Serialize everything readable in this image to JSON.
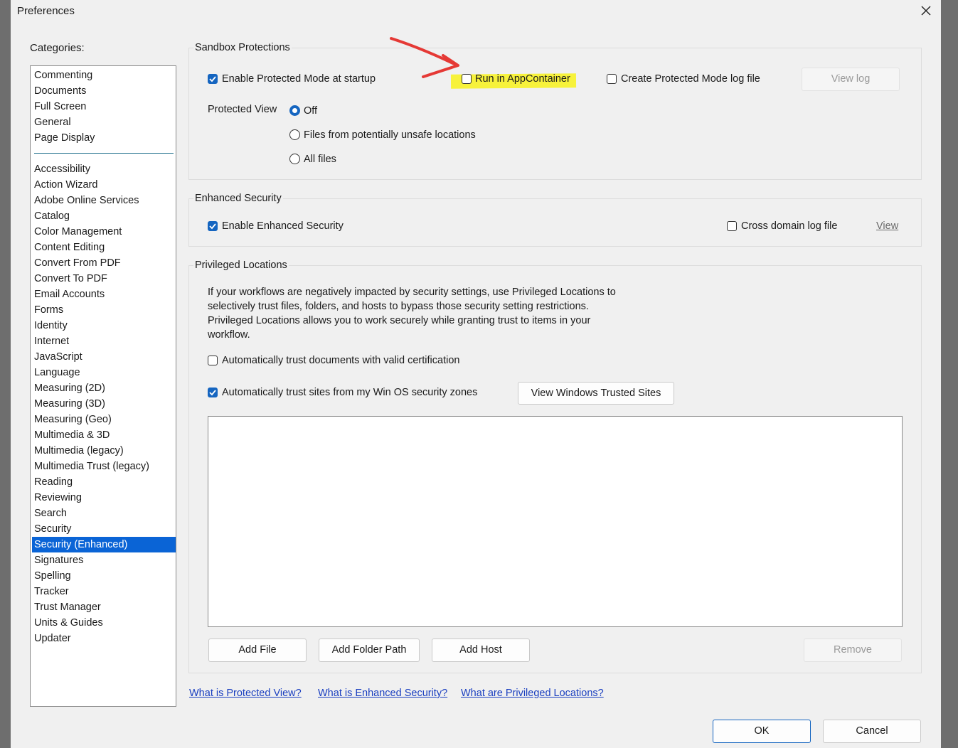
{
  "window": {
    "title": "Preferences"
  },
  "categories": {
    "label": "Categories:",
    "top_items": [
      "Commenting",
      "Documents",
      "Full Screen",
      "General",
      "Page Display"
    ],
    "items": [
      "Accessibility",
      "Action Wizard",
      "Adobe Online Services",
      "Catalog",
      "Color Management",
      "Content Editing",
      "Convert From PDF",
      "Convert To PDF",
      "Email Accounts",
      "Forms",
      "Identity",
      "Internet",
      "JavaScript",
      "Language",
      "Measuring (2D)",
      "Measuring (3D)",
      "Measuring (Geo)",
      "Multimedia & 3D",
      "Multimedia (legacy)",
      "Multimedia Trust (legacy)",
      "Reading",
      "Reviewing",
      "Search",
      "Security",
      "Security (Enhanced)",
      "Signatures",
      "Spelling",
      "Tracker",
      "Trust Manager",
      "Units & Guides",
      "Updater"
    ],
    "selected": "Security (Enhanced)"
  },
  "sandbox": {
    "legend": "Sandbox Protections",
    "enable_protected_mode": {
      "label": "Enable Protected Mode at startup",
      "checked": true
    },
    "run_in_appcontainer": {
      "label": "Run in AppContainer",
      "checked": false
    },
    "create_log": {
      "label": "Create Protected Mode log file",
      "checked": false
    },
    "view_log_button": "View log",
    "protected_view_label": "Protected View",
    "protected_view_options": [
      "Off",
      "Files from potentially unsafe locations",
      "All files"
    ],
    "protected_view_selected": "Off"
  },
  "enhanced": {
    "legend": "Enhanced Security",
    "enable_enhanced": {
      "label": "Enable Enhanced Security",
      "checked": true
    },
    "cross_domain": {
      "label": "Cross domain log file",
      "checked": false
    },
    "view_link": "View"
  },
  "privileged": {
    "legend": "Privileged Locations",
    "description_lines": [
      "If your workflows are negatively impacted by security settings, use Privileged Locations to",
      "selectively trust files, folders, and hosts to bypass those security setting restrictions.",
      "Privileged Locations allows you to work securely while granting trust to items in your",
      "workflow."
    ],
    "trust_certified": {
      "label": "Automatically trust documents with valid certification",
      "checked": false
    },
    "trust_win_zones": {
      "label": "Automatically trust sites from my Win OS security zones",
      "checked": true
    },
    "view_trusted_sites_button": "View Windows Trusted Sites",
    "add_file_button": "Add File",
    "add_folder_button": "Add Folder Path",
    "add_host_button": "Add Host",
    "remove_button": "Remove"
  },
  "help_links": [
    "What is Protected View?",
    "What is Enhanced Security?",
    "What are Privileged Locations?"
  ],
  "footer": {
    "ok": "OK",
    "cancel": "Cancel"
  },
  "annotation": {
    "arrow_color": "#e53935",
    "highlight_color": "#f7f23b"
  }
}
